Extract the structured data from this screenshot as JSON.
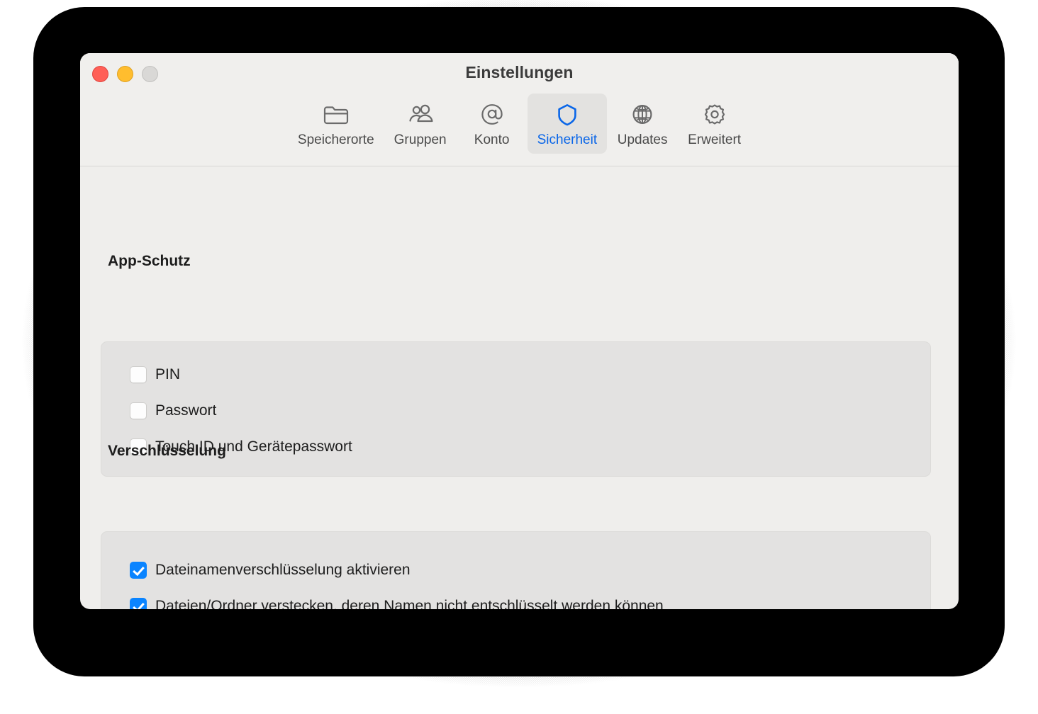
{
  "window": {
    "title": "Einstellungen",
    "traffic_lights": [
      {
        "name": "close",
        "color": "#ff5f57"
      },
      {
        "name": "minimize",
        "color": "#ffbd2e"
      },
      {
        "name": "zoom",
        "color": "#d9d8d6"
      }
    ]
  },
  "toolbar": {
    "tabs": [
      {
        "label": "Speicherorte",
        "icon": "folder-icon",
        "selected": false
      },
      {
        "label": "Gruppen",
        "icon": "people-icon",
        "selected": false
      },
      {
        "label": "Konto",
        "icon": "at-sign-icon",
        "selected": false
      },
      {
        "label": "Sicherheit",
        "icon": "shield-icon",
        "selected": true
      },
      {
        "label": "Updates",
        "icon": "globe-icon",
        "selected": false
      },
      {
        "label": "Erweitert",
        "icon": "gear-icon",
        "selected": false
      }
    ],
    "accent_color": "#0a66e8",
    "selected_background": "#e3e2e0"
  },
  "sections": [
    {
      "title": "App-Schutz",
      "options": [
        {
          "label": "PIN",
          "checked": false
        },
        {
          "label": "Passwort",
          "checked": false
        },
        {
          "label": "Touch ID und Gerätepasswort",
          "checked": false
        }
      ]
    },
    {
      "title": "Verschlüsselung",
      "options": [
        {
          "label": "Dateinamenverschlüsselung aktivieren",
          "checked": true
        },
        {
          "label": "Dateien/Ordner verstecken, deren Namen nicht entschlüsselt werden können",
          "checked": true
        }
      ]
    }
  ],
  "help": {
    "label": "?"
  },
  "colors": {
    "page_background": "#efeeec",
    "group_background": "#e3e2e1",
    "checkbox_on": "#0a84ff",
    "text": "#1d1d1d"
  }
}
